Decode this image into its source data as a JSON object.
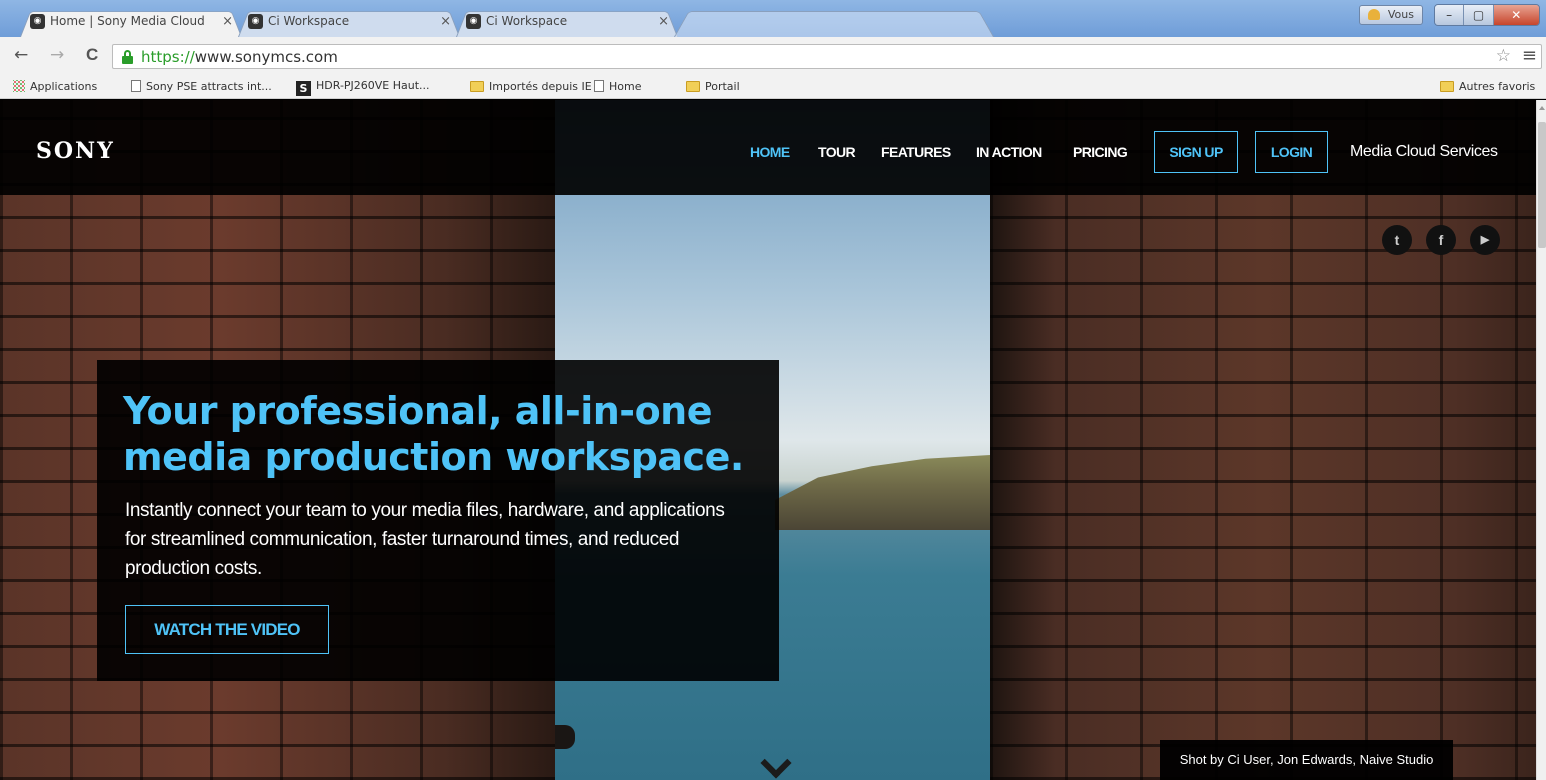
{
  "browser": {
    "tabs": [
      {
        "title": "Home | Sony Media Cloud",
        "active": true
      },
      {
        "title": "Ci Workspace",
        "active": false
      },
      {
        "title": "Ci Workspace",
        "active": false
      }
    ],
    "tab_close_glyph": "×",
    "user_button_label": "Vous",
    "window_buttons": {
      "minimize": "–",
      "maximize": "▢",
      "close": "✕"
    },
    "nav": {
      "back": "←",
      "forward": "→",
      "reload": "C"
    },
    "address": {
      "protocol": "https://",
      "host": "www.sonymcs.com"
    },
    "star_glyph": "☆",
    "menu_glyph": "≡",
    "bookmarks": [
      {
        "label": "Applications",
        "icon": "apps-icon"
      },
      {
        "label": "Sony PSE attracts int...",
        "icon": "page-icon"
      },
      {
        "label": "HDR-PJ260VE Haut...",
        "icon": "s-icon"
      },
      {
        "label": "Importés depuis IE",
        "icon": "folder-icon"
      },
      {
        "label": "Home",
        "icon": "page-icon"
      },
      {
        "label": "Portail",
        "icon": "folder-icon"
      }
    ],
    "other_bookmarks": "Autres favoris"
  },
  "site": {
    "logo": "SONY",
    "nav": {
      "home": "HOME",
      "tour": "TOUR",
      "features": "FEATURES",
      "in_action": "IN ACTION",
      "pricing": "PRICING",
      "sign_up": "SIGN UP",
      "login": "LOGIN"
    },
    "brand": "Media Cloud Services",
    "social": {
      "twitter": "t",
      "facebook": "f",
      "youtube": "▶"
    },
    "hero": {
      "title": "Your professional, all-in-one media production workspace.",
      "body": "Instantly connect your team to your media files, hardware, and applications for streamlined communication, faster turnaround times, and reduced production costs.",
      "cta": "WATCH THE VIDEO"
    },
    "photo_credit": "Shot by Ci User, Jon Edwards, Naive Studio"
  },
  "colors": {
    "accent": "#4fc3f7",
    "header_bg": "#000000",
    "secure": "#2a9d2a"
  }
}
